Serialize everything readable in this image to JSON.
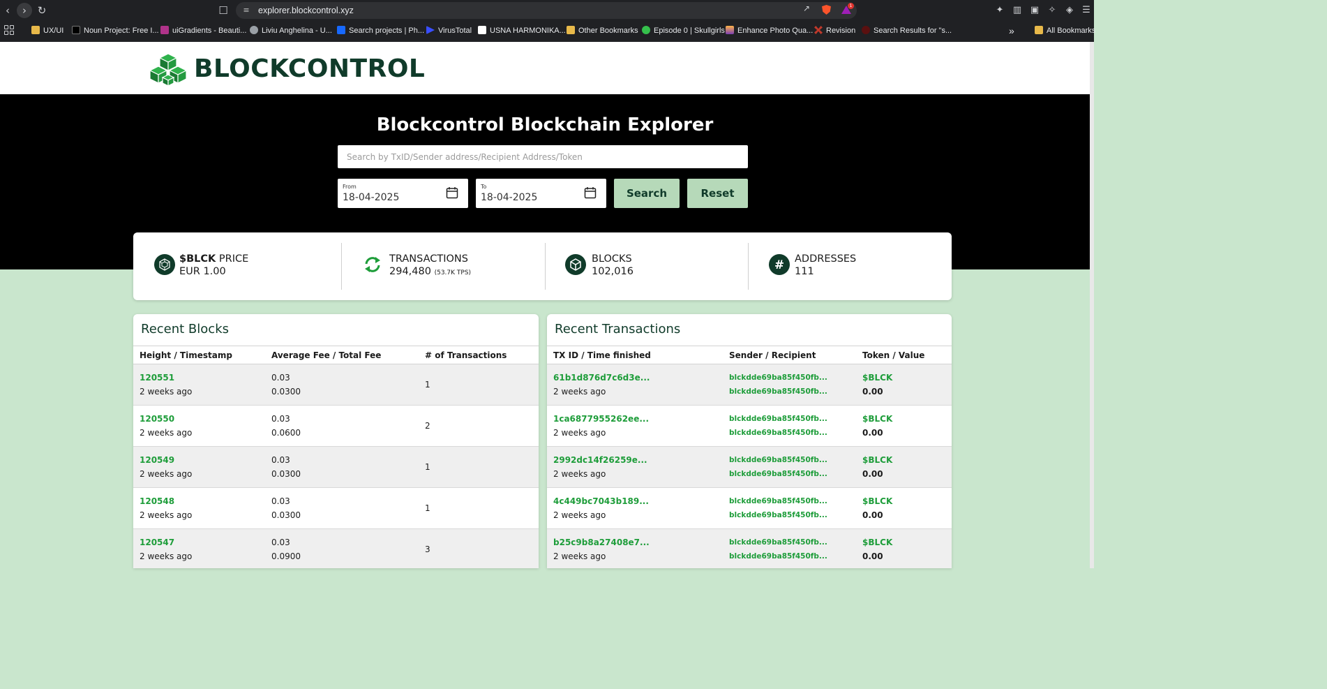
{
  "browser": {
    "url": "explorer.blockcontrol.xyz",
    "badge_count": "1",
    "bookmarks": [
      {
        "label": "UX/UI",
        "icon": "folder-icon"
      },
      {
        "label": "Noun Project: Free I...",
        "icon": "noun-project-icon"
      },
      {
        "label": "uiGradients - Beauti...",
        "icon": "uigradients-icon"
      },
      {
        "label": "Liviu Anghelina - U...",
        "icon": "globe-icon"
      },
      {
        "label": "Search projects | Ph...",
        "icon": "behance-icon"
      },
      {
        "label": "VirusTotal",
        "icon": "virustotal-icon"
      },
      {
        "label": "USNA HARMONIKA...",
        "icon": "usna-icon"
      },
      {
        "label": "Other Bookmarks",
        "icon": "folder-icon"
      },
      {
        "label": "Episode 0 | Skullgirls",
        "icon": "skullgirls-icon"
      },
      {
        "label": "Enhance Photo Qua...",
        "icon": "enhance-icon"
      },
      {
        "label": "Revision",
        "icon": "revision-icon"
      },
      {
        "label": "Search Results for \"s...",
        "icon": "search-results-icon"
      }
    ],
    "all_bookmarks": "All Bookmarks",
    "more_bookmarks": "»"
  },
  "site": {
    "logo_text": "BLOCKCONTROL",
    "brand_color": "#103b2a",
    "accent_color": "#1e9d3a"
  },
  "hero": {
    "title": "Blockcontrol Blockchain Explorer",
    "search_placeholder": "Search by TxID/Sender address/Recipient Address/Token",
    "from_label": "From",
    "from_value": "18-04-2025",
    "to_label": "To",
    "to_value": "18-04-2025",
    "search_button": "Search",
    "reset_button": "Reset"
  },
  "stats": {
    "price": {
      "bold": "$BLCK",
      "title": " PRICE",
      "value": "EUR 1.00"
    },
    "transactions": {
      "title": "TRANSACTIONS",
      "value": "294,480",
      "sub": "(53.7K TPS)"
    },
    "blocks": {
      "title": "BLOCKS",
      "value": "102,016"
    },
    "addresses": {
      "title": "ADDRESSES",
      "value": "111"
    }
  },
  "recent_blocks": {
    "title": "Recent Blocks",
    "columns": [
      "Height / Timestamp",
      "Average Fee / Total Fee",
      "# of Transactions"
    ],
    "rows": [
      {
        "height": "120551",
        "time": "2 weeks ago",
        "avg_fee": "0.03",
        "total_fee": "0.0300",
        "tx_count": "1"
      },
      {
        "height": "120550",
        "time": "2 weeks ago",
        "avg_fee": "0.03",
        "total_fee": "0.0600",
        "tx_count": "2"
      },
      {
        "height": "120549",
        "time": "2 weeks ago",
        "avg_fee": "0.03",
        "total_fee": "0.0300",
        "tx_count": "1"
      },
      {
        "height": "120548",
        "time": "2 weeks ago",
        "avg_fee": "0.03",
        "total_fee": "0.0300",
        "tx_count": "1"
      },
      {
        "height": "120547",
        "time": "2 weeks ago",
        "avg_fee": "0.03",
        "total_fee": "0.0900",
        "tx_count": "3"
      }
    ]
  },
  "recent_transactions": {
    "title": "Recent Transactions",
    "columns": [
      "TX ID / Time finished",
      "Sender / Recipient",
      "Token / Value"
    ],
    "rows": [
      {
        "tx_id": "61b1d876d7c6d3e...",
        "time": "2 weeks ago",
        "sender": "blckdde69ba85f450fb...",
        "recipient": "blckdde69ba85f450fb...",
        "token": "$BLCK",
        "value": "0.00"
      },
      {
        "tx_id": "1ca6877955262ee...",
        "time": "2 weeks ago",
        "sender": "blckdde69ba85f450fb...",
        "recipient": "blckdde69ba85f450fb...",
        "token": "$BLCK",
        "value": "0.00"
      },
      {
        "tx_id": "2992dc14f26259e...",
        "time": "2 weeks ago",
        "sender": "blckdde69ba85f450fb...",
        "recipient": "blckdde69ba85f450fb...",
        "token": "$BLCK",
        "value": "0.00"
      },
      {
        "tx_id": "4c449bc7043b189...",
        "time": "2 weeks ago",
        "sender": "blckdde69ba85f450fb...",
        "recipient": "blckdde69ba85f450fb...",
        "token": "$BLCK",
        "value": "0.00"
      },
      {
        "tx_id": "b25c9b8a27408e7...",
        "time": "2 weeks ago",
        "sender": "blckdde69ba85f450fb...",
        "recipient": "blckdde69ba85f450fb...",
        "token": "$BLCK",
        "value": "0.00"
      }
    ]
  }
}
